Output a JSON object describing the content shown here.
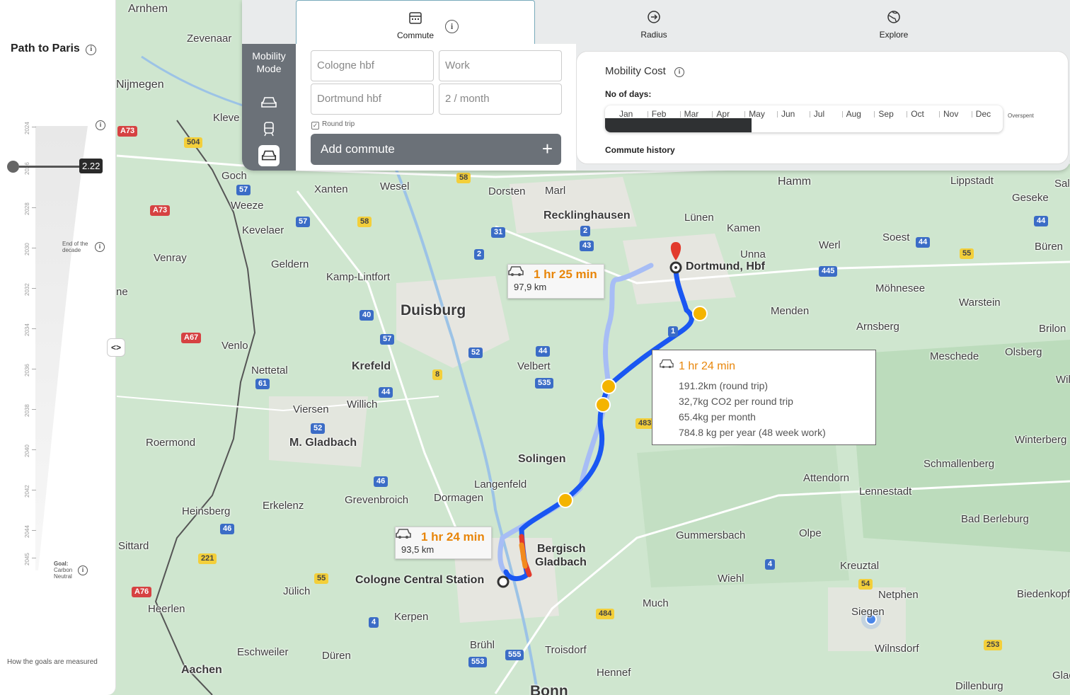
{
  "left_panel": {
    "title": "Path to Paris",
    "years": [
      "2024",
      "2026",
      "2028",
      "2030",
      "2032",
      "2034",
      "2036",
      "2038",
      "2040",
      "2042",
      "2044",
      "2045"
    ],
    "slider_value": "2.22",
    "end_of_decade": [
      "End of the",
      "decade"
    ],
    "goal": [
      "Goal:",
      "Carbon",
      "Neutral"
    ],
    "footer_link": "How the goals are measured",
    "collapse_label": "<>"
  },
  "tabs": [
    {
      "label": "Commute",
      "icon": "calendar-icon",
      "active": true
    },
    {
      "label": "Radius",
      "icon": "arrow-circle-icon",
      "active": false
    },
    {
      "label": "Explore",
      "icon": "globe-icon",
      "active": false
    }
  ],
  "mobility": {
    "caption_line1": "Mobility",
    "caption_line2": "Mode",
    "modes": [
      "car-icon",
      "train-icon",
      "car-icon"
    ],
    "selected_mode": 2
  },
  "form": {
    "origin_placeholder": "Cologne hbf",
    "destination_placeholder": "Work",
    "origin2_placeholder": "Dortmund hbf",
    "frequency_placeholder": "2 / month",
    "round_trip_label": "Round trip",
    "round_trip_checked": true,
    "add_commute_label": "Add commute",
    "add_icon": "+"
  },
  "cost": {
    "title": "Mobility Cost",
    "days_label": "No of days:",
    "months": [
      "Jan",
      "Feb",
      "Mar",
      "Apr",
      "May",
      "Jun",
      "Jul",
      "Aug",
      "Sep",
      "Oct",
      "Nov",
      "Dec"
    ],
    "filled_fraction": 0.368,
    "overspent_label": "Overspent",
    "history_label": "Commute history"
  },
  "map": {
    "cities_big": [
      "Duisburg"
    ],
    "cities": [
      "Arnhem",
      "Zevenaar",
      "Nijmegen",
      "Kleve",
      "Goch",
      "Xanten",
      "Wesel",
      "Dorsten",
      "Marl",
      "Hamm",
      "Lippstadt",
      "Salzkotten",
      "Geseke",
      "Weeze",
      "Recklinghausen",
      "Lünen",
      "Kamen",
      "Soest",
      "Büren",
      "Kevelaer",
      "Venray",
      "Geldern",
      "Kamp-Lintfort",
      "Unna",
      "Werl",
      "Möhnesee",
      "Warstein",
      "Menden",
      "Arnsberg",
      "Brilon",
      "Venlo",
      "Krefeld",
      "Velbert",
      "Meschede",
      "Olsberg",
      "Nettetal",
      "Willich",
      "Viersen",
      "Roermond",
      "M. Gladbach",
      "Solingen",
      "Winterberg",
      "Schmallenberg",
      "Attendorn",
      "Lennestadt",
      "Langenfeld",
      "Grevenbroich",
      "Dormagen",
      "Heinsberg",
      "Erkelenz",
      "Bad Berleburg",
      "Sittard",
      "Gummersbach",
      "Olpe",
      "Kreuztal",
      "Jülich",
      "Wiehl",
      "Netphen",
      "Biedenkopf",
      "Heerlen",
      "Much",
      "Kerpen",
      "Eschweiler",
      "Düren",
      "Brühl",
      "Troisdorf",
      "Hennef",
      "Wilnsdorf",
      "Aachen",
      "Dillenburg",
      "Gladenbach",
      "Bonn",
      "ne",
      "Wil",
      "Siegen"
    ],
    "bold_places": [
      "Bergisch",
      "Gladbach",
      "Cologne Central Station",
      "Dortmund, Hbf"
    ],
    "shields": [
      "A73",
      "504",
      "57",
      "A73",
      "57",
      "58",
      "58",
      "31",
      "2",
      "2",
      "43",
      "40",
      "57",
      "52",
      "44",
      "8",
      "535",
      "44",
      "A67",
      "61",
      "52",
      "46",
      "46",
      "221",
      "55",
      "A76",
      "4",
      "555",
      "553",
      "484",
      "4",
      "54",
      "253",
      "483",
      "44",
      "55",
      "44",
      "445",
      "1"
    ],
    "route_cards": [
      {
        "time": "1 hr 25 min",
        "distance": "97,9 km"
      },
      {
        "time": "1 hr 24 min",
        "distance": "93,5 km"
      }
    ]
  },
  "info_box": {
    "time": "1 hr 24 min",
    "rows": [
      "191.2km (round trip)",
      "32,7kg CO2 per round trip",
      "65.4kg per month",
      "784.8 kg per year (48 week work)"
    ]
  },
  "colors": {
    "route_main": "#1a57f2",
    "route_alt": "#a7bdf5",
    "accent_orange": "#e8860b",
    "panel_dark": "#6b7178",
    "map_green": "#cfe6cf"
  }
}
